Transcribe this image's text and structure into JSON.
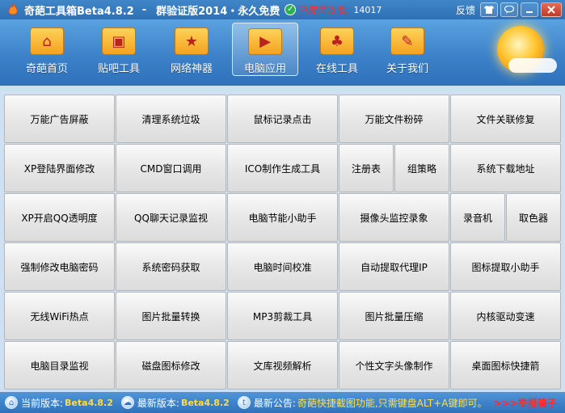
{
  "window": {
    "title": "奇葩工具箱Beta4.8.2",
    "separator": "-",
    "edition": "群验证版2014・永久免费",
    "usage_label": "已使用次数:",
    "usage_count": "14017",
    "feedback": "反馈"
  },
  "icons": {
    "app": "flame-icon",
    "verified": "check-icon",
    "skin": "shirt-icon",
    "chat": "speech-bubble-icon",
    "minimize": "minimize-icon",
    "close": "close-icon",
    "weather": "sun-icon"
  },
  "nav": [
    {
      "label": "奇葩首页",
      "icon": "home-folder-icon"
    },
    {
      "label": "贴吧工具",
      "icon": "photo-folder-icon"
    },
    {
      "label": "网络神器",
      "icon": "star-folder-icon"
    },
    {
      "label": "电脑应用",
      "icon": "media-folder-icon",
      "active": true
    },
    {
      "label": "在线工具",
      "icon": "mushroom-folder-icon"
    },
    {
      "label": "关于我们",
      "icon": "tag-folder-icon"
    }
  ],
  "grid": {
    "row1": [
      "万能广告屏蔽",
      "清理系统垃圾",
      "鼠标记录点击",
      "万能文件粉碎",
      "文件关联修复"
    ],
    "row2": [
      "XP登陆界面修改",
      "CMD窗口调用",
      "ICO制作生成工具",
      "注册表",
      "组策略",
      "系统下载地址"
    ],
    "row3": [
      "XP开启QQ透明度",
      "QQ聊天记录监视",
      "电脑节能小助手",
      "摄像头监控录象",
      "录音机",
      "取色器"
    ],
    "row4": [
      "强制修改电脑密码",
      "系统密码获取",
      "电脑时间校准",
      "自动提取代理IP",
      "图标提取小助手"
    ],
    "row5": [
      "无线WiFi热点",
      "图片批量转换",
      "MP3剪裁工具",
      "图片批量压缩",
      "内核驱动变速"
    ],
    "row6": [
      "电脑目录监视",
      "磁盘图标修改",
      "文库视频解析",
      "个性文字头像制作",
      "桌面图标快捷箭"
    ]
  },
  "status": {
    "current_label": "当前版本:",
    "current_value": "Beta4.8.2",
    "latest_label": "最新版本:",
    "latest_value": "Beta4.8.2",
    "notice_label": "最新公告:",
    "notice_text": "奇葩快捷截图功能,只需键盘ALT+A键即可。",
    "report": ">>>举报骗子"
  },
  "colors": {
    "titlebar": "#3a80c4",
    "accent_red": "#ff2a2a",
    "notice_yellow": "#ffe04a",
    "grid_bg": "#cfe0f2"
  }
}
